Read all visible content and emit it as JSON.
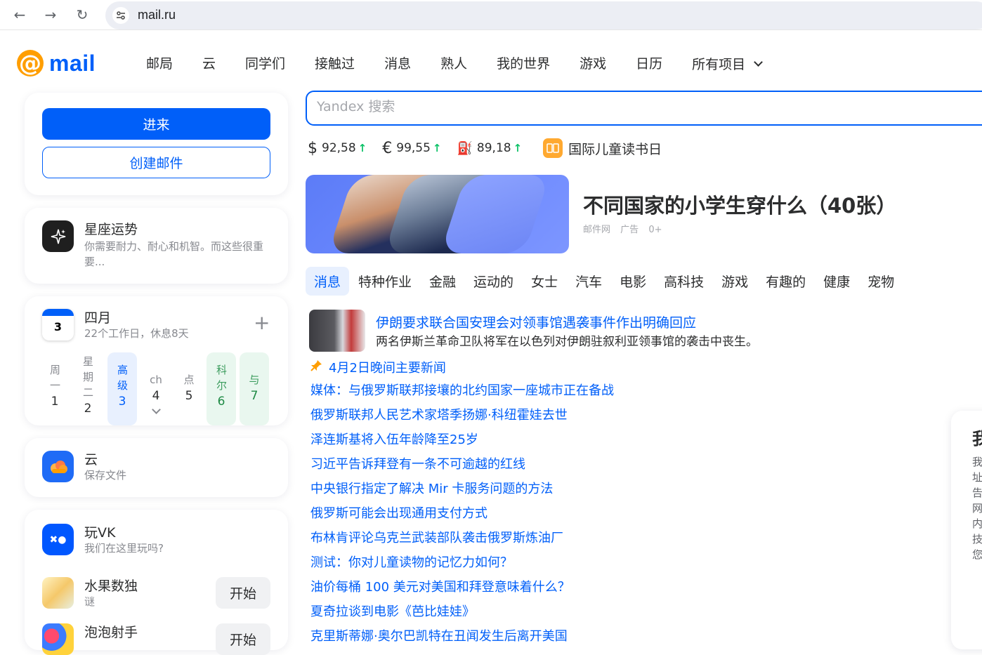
{
  "browser": {
    "url": "mail.ru",
    "back_glyph": "←",
    "forward_glyph": "→",
    "reload_glyph": "↻"
  },
  "header": {
    "logo_text": "mail",
    "logo_symbol": "@",
    "nav": [
      "邮局",
      "云",
      "同学们",
      "接触过",
      "消息",
      "熟人",
      "我的世界",
      "游戏",
      "日历"
    ],
    "more_label": "所有项目"
  },
  "auth": {
    "login_label": "进来",
    "create_label": "创建邮件"
  },
  "horoscope": {
    "title": "星座运势",
    "text": "你需要耐力、耐心和机智。而这些很重要..."
  },
  "calendar": {
    "icon_day": "3",
    "month": "四月",
    "summary": "22个工作日，休息8天",
    "add_glyph": "+",
    "days": [
      {
        "label": "周一",
        "num": "1",
        "style": "plain"
      },
      {
        "label": "星期二",
        "num": "2",
        "style": "plain"
      },
      {
        "label": "高级",
        "num": "3",
        "style": "today"
      },
      {
        "label": "ch",
        "num": "4",
        "style": "plain"
      },
      {
        "label": "点",
        "num": "5",
        "style": "plain"
      },
      {
        "label": "科尔",
        "num": "6",
        "style": "weekend"
      },
      {
        "label": "与",
        "num": "7",
        "style": "weekend"
      }
    ]
  },
  "cloud": {
    "title": "云",
    "subtitle": "保存文件"
  },
  "games": {
    "title": "玩VK",
    "subtitle": "我们在这里玩吗?",
    "icon_text": "✖●",
    "items": [
      {
        "title": "水果数独",
        "subtitle": "谜",
        "button": "开始"
      },
      {
        "title": "泡泡射手",
        "subtitle": "",
        "button": "开始"
      }
    ]
  },
  "search": {
    "placeholder": "Yandex 搜索"
  },
  "rates": [
    {
      "symbol": "$",
      "value": "92,58",
      "trend": "↑"
    },
    {
      "symbol": "€",
      "value": "99,55",
      "trend": "↑"
    },
    {
      "symbol": "⛽",
      "value": "89,18",
      "trend": "↑"
    }
  ],
  "holiday": "国际儿童读书日",
  "promo": {
    "title": "不同国家的小学生穿什么（40张）",
    "meta": [
      "邮件网",
      "广告",
      "0+"
    ]
  },
  "tabs": [
    "消息",
    "特种作业",
    "金融",
    "运动的",
    "女士",
    "汽车",
    "电影",
    "高科技",
    "游戏",
    "有趣的",
    "健康",
    "宠物"
  ],
  "lead": {
    "title": "伊朗要求联合国安理会对领事馆遇袭事件作出明确回应",
    "subtitle": "两名伊斯兰革命卫队将军在以色列对伊朗驻叙利亚领事馆的袭击中丧生。"
  },
  "pinned": "4月2日晚间主要新闻",
  "news": [
    "媒体：与俄罗斯联邦接壤的北约国家一座城市正在备战",
    "俄罗斯联邦人民艺术家塔季扬娜·科纽霍娃去世",
    "泽连斯基将入伍年龄降至25岁",
    "习近平告诉拜登有一条不可逾越的红线",
    "中央银行指定了解决 Mir 卡服务问题的方法",
    "俄罗斯可能会出现通用支付方式",
    "布林肯评论乌克兰武装部队袭击俄罗斯炼油厂",
    "测试：你对儿童读物的记忆力如何？",
    "油价每桶 100 美元对美国和拜登意味着什么？",
    "夏奇拉谈到电影《芭比娃娃》",
    "克里斯蒂娜·奥尔巴凯特在丑闻发生后离开美国"
  ],
  "side_widget": {
    "title": "我",
    "text": "我址告网内技您"
  },
  "colors": {
    "brand_blue": "#005ff9",
    "brand_orange": "#ff9e00",
    "trend_green": "#0dc268"
  }
}
